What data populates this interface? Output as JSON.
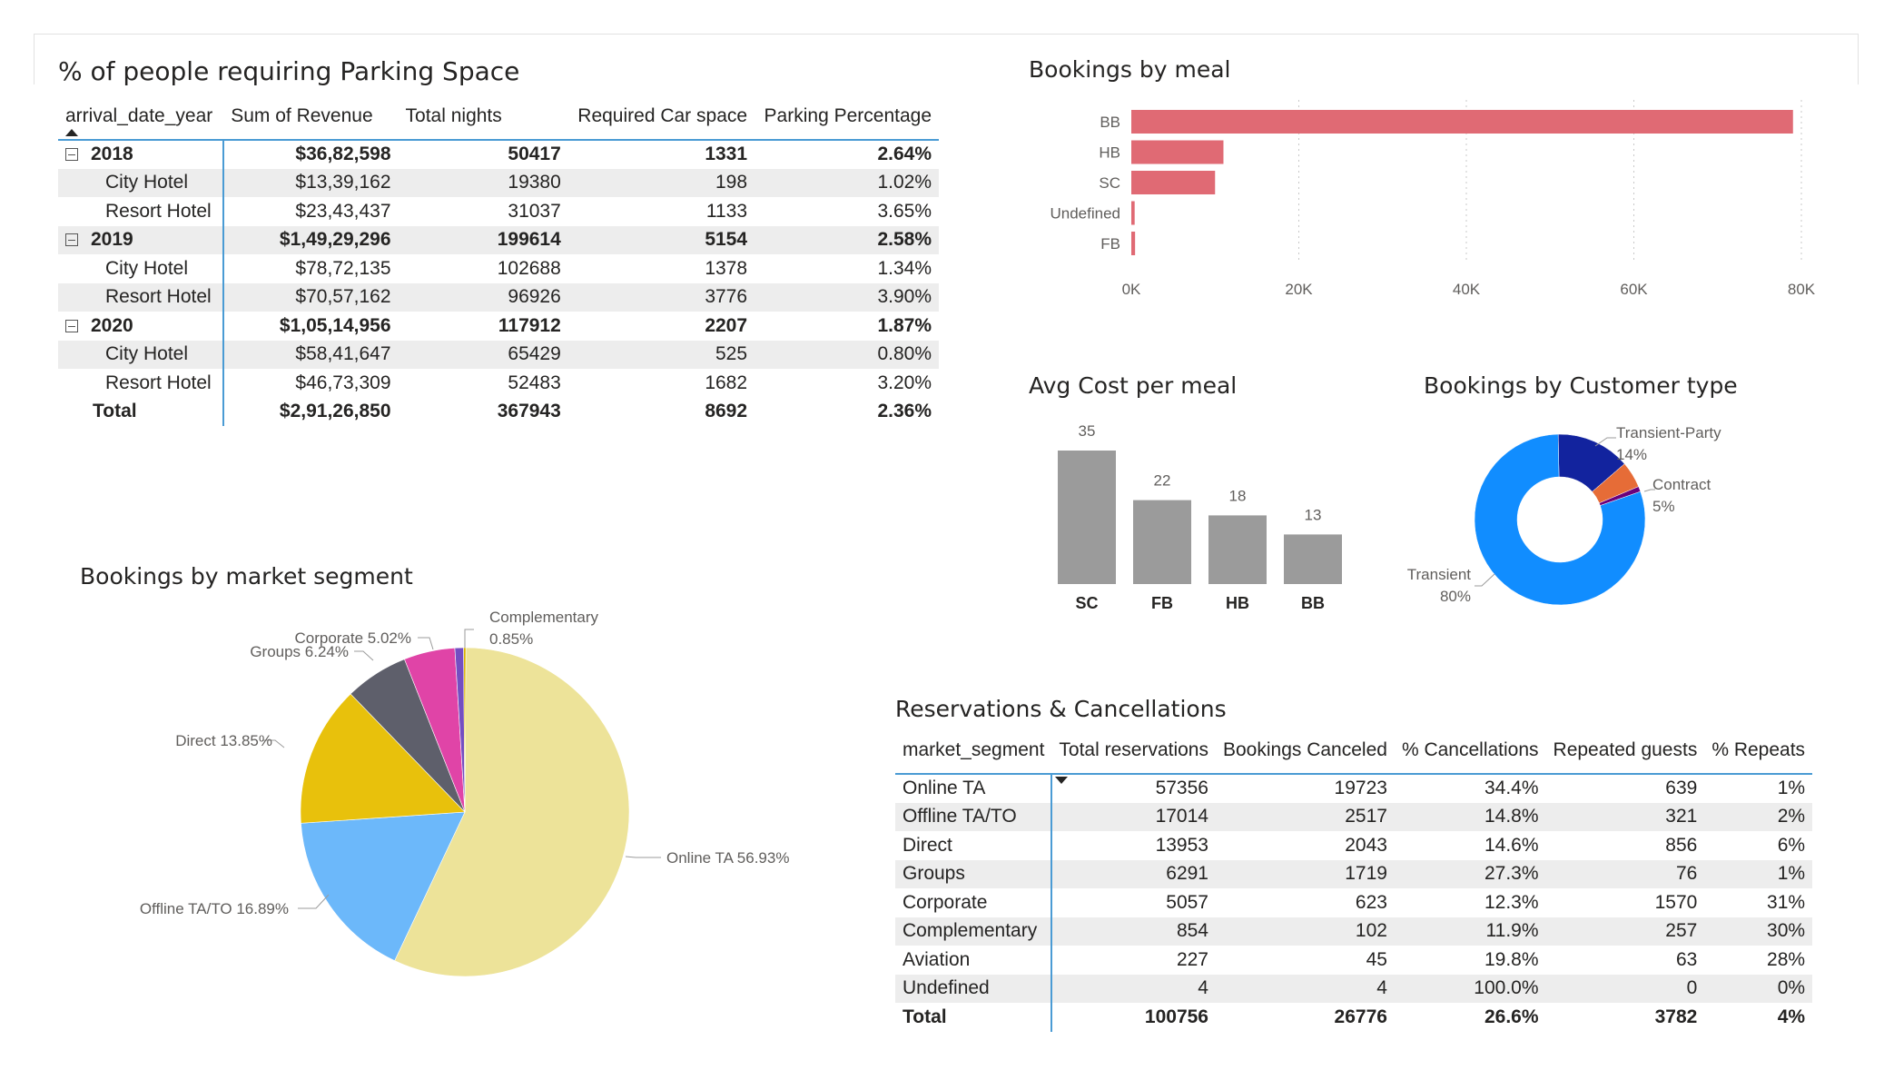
{
  "parking": {
    "title": "% of people requiring Parking Space",
    "columns": [
      "arrival_date_year",
      "Sum of Revenue",
      "Total nights",
      "Required Car space",
      "Parking Percentage"
    ],
    "rows": [
      {
        "level": 0,
        "label": "2018",
        "revenue": "$36,82,598",
        "nights": "50417",
        "car": "1331",
        "pct": "2.64%"
      },
      {
        "level": 1,
        "label": "City Hotel",
        "revenue": "$13,39,162",
        "nights": "19380",
        "car": "198",
        "pct": "1.02%"
      },
      {
        "level": 1,
        "label": "Resort Hotel",
        "revenue": "$23,43,437",
        "nights": "31037",
        "car": "1133",
        "pct": "3.65%"
      },
      {
        "level": 0,
        "label": "2019",
        "revenue": "$1,49,29,296",
        "nights": "199614",
        "car": "5154",
        "pct": "2.58%"
      },
      {
        "level": 1,
        "label": "City Hotel",
        "revenue": "$78,72,135",
        "nights": "102688",
        "car": "1378",
        "pct": "1.34%"
      },
      {
        "level": 1,
        "label": "Resort Hotel",
        "revenue": "$70,57,162",
        "nights": "96926",
        "car": "3776",
        "pct": "3.90%"
      },
      {
        "level": 0,
        "label": "2020",
        "revenue": "$1,05,14,956",
        "nights": "117912",
        "car": "2207",
        "pct": "1.87%"
      },
      {
        "level": 1,
        "label": "City Hotel",
        "revenue": "$58,41,647",
        "nights": "65429",
        "car": "525",
        "pct": "0.80%"
      },
      {
        "level": 1,
        "label": "Resort Hotel",
        "revenue": "$46,73,309",
        "nights": "52483",
        "car": "1682",
        "pct": "3.20%"
      }
    ],
    "total": {
      "label": "Total",
      "revenue": "$2,91,26,850",
      "nights": "367943",
      "car": "8692",
      "pct": "2.36%"
    }
  },
  "reservations": {
    "title": "Reservations & Cancellations",
    "columns": [
      "market_segment",
      "Total reservations",
      "Bookings Canceled",
      "% Cancellations",
      "Repeated guests",
      "% Repeats"
    ],
    "rows": [
      [
        "Online TA",
        "57356",
        "19723",
        "34.4%",
        "639",
        "1%"
      ],
      [
        "Offline TA/TO",
        "17014",
        "2517",
        "14.8%",
        "321",
        "2%"
      ],
      [
        "Direct",
        "13953",
        "2043",
        "14.6%",
        "856",
        "6%"
      ],
      [
        "Groups",
        "6291",
        "1719",
        "27.3%",
        "76",
        "1%"
      ],
      [
        "Corporate",
        "5057",
        "623",
        "12.3%",
        "1570",
        "31%"
      ],
      [
        "Complementary",
        "854",
        "102",
        "11.9%",
        "257",
        "30%"
      ],
      [
        "Aviation",
        "227",
        "45",
        "19.8%",
        "63",
        "28%"
      ],
      [
        "Undefined",
        "4",
        "4",
        "100.0%",
        "0",
        "0%"
      ]
    ],
    "total": [
      "Total",
      "100756",
      "26776",
      "26.6%",
      "3782",
      "4%"
    ]
  },
  "chart_data": [
    {
      "id": "meal",
      "type": "bar",
      "orientation": "horizontal",
      "title": "Bookings by meal",
      "categories": [
        "BB",
        "HB",
        "SC",
        "Undefined",
        "FB"
      ],
      "values": [
        79000,
        11000,
        10000,
        400,
        450
      ],
      "xlim": [
        0,
        80000
      ],
      "ticks": [
        0,
        20000,
        40000,
        60000,
        80000
      ],
      "tick_labels": [
        "0K",
        "20K",
        "40K",
        "60K",
        "80K"
      ],
      "color": "#e06a74",
      "grid": true
    },
    {
      "id": "cost",
      "type": "bar",
      "title": "Avg Cost per meal",
      "categories": [
        "SC",
        "FB",
        "HB",
        "BB"
      ],
      "values": [
        35,
        22,
        18,
        13
      ],
      "color": "#9b9b9b"
    },
    {
      "id": "customer",
      "type": "pie",
      "donut": true,
      "title": "Bookings by Customer type",
      "slices": [
        {
          "label": "Transient",
          "value": 80,
          "display": "80%",
          "color": "#118dff"
        },
        {
          "label": "Transient-Party",
          "value": 14,
          "display": "14%",
          "color": "#12239e"
        },
        {
          "label": "Contract",
          "value": 5,
          "display": "5%",
          "color": "#e66c37"
        },
        {
          "label": "",
          "value": 1,
          "display": "",
          "color": "#6b007b"
        }
      ]
    },
    {
      "id": "segment",
      "type": "pie",
      "title": "Bookings by market segment",
      "slices": [
        {
          "label": "Online TA",
          "value": 56.93,
          "display": "Online TA 56.93%",
          "color": "#ede399"
        },
        {
          "label": "Offline TA/TO",
          "value": 16.89,
          "display": "Offline TA/TO 16.89%",
          "color": "#6cb8fa"
        },
        {
          "label": "Direct",
          "value": 13.85,
          "display": "Direct 13.85%",
          "color": "#e8c10c"
        },
        {
          "label": "Groups",
          "value": 6.24,
          "display": "Groups 6.24%",
          "color": "#5e5f6b"
        },
        {
          "label": "Corporate",
          "value": 5.02,
          "display": "Corporate 5.02%",
          "color": "#e044a7"
        },
        {
          "label": "Complementary",
          "value": 0.85,
          "display": "Complementary 0.85%",
          "color": "#744ec2"
        },
        {
          "label": "",
          "value": 0.22,
          "display": "",
          "color": "#d9b300"
        }
      ]
    }
  ]
}
